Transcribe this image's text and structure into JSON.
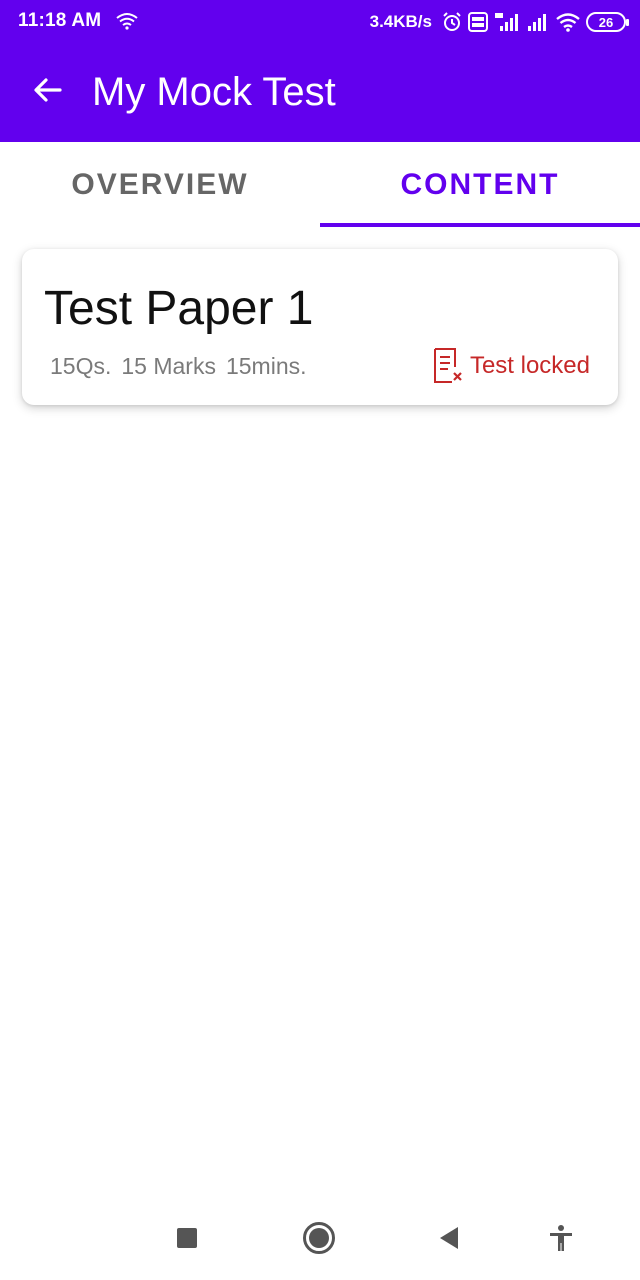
{
  "status_bar": {
    "time": "11:18 AM",
    "net_speed": "3.4KB/s",
    "battery": "26",
    "icons": [
      "wifi-icon",
      "alarm-icon",
      "volte-icon",
      "4g-signal-icon",
      "signal-icon",
      "wifi-icon",
      "battery-icon"
    ]
  },
  "app_bar": {
    "title": "My Mock Test",
    "back_icon": "arrow-left-icon"
  },
  "tabs": [
    {
      "label": "OVERVIEW",
      "selected": false
    },
    {
      "label": "CONTENT",
      "selected": true
    }
  ],
  "tests": [
    {
      "title": "Test Paper 1",
      "questions": "15Qs.",
      "marks": "15 Marks",
      "duration": "15mins.",
      "status": "Test locked",
      "status_icon": "locked-document-icon"
    }
  ],
  "nav_bar": {
    "icons": [
      "recents-square-icon",
      "home-circle-icon",
      "back-triangle-icon",
      "accessibility-icon"
    ]
  },
  "colors": {
    "primary": "#6200ee",
    "locked": "#c62828",
    "muted_text": "#7a7a7a",
    "tab_inactive": "#666666"
  }
}
